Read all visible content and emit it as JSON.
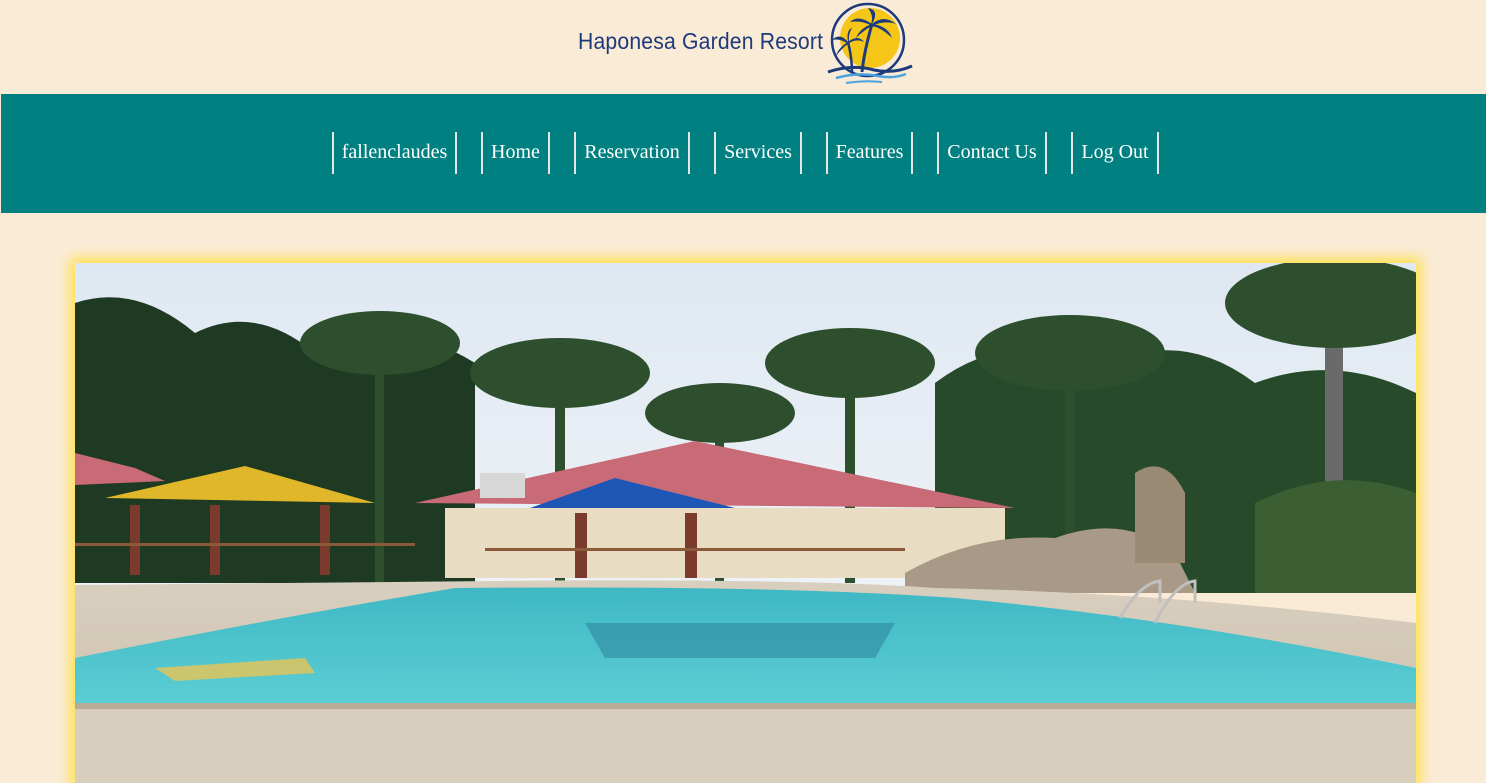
{
  "header": {
    "brand_name": "Haponesa Garden Resort",
    "logo_icon": "palm-tree-sun-logo-icon"
  },
  "nav": {
    "items": [
      {
        "label": "fallenclaudes"
      },
      {
        "label": "Home"
      },
      {
        "label": "Reservation"
      },
      {
        "label": "Services"
      },
      {
        "label": "Features"
      },
      {
        "label": "Contact Us"
      },
      {
        "label": "Log Out"
      }
    ]
  },
  "hero": {
    "image": "resort-pool-photo"
  },
  "colors": {
    "page_background": "#faebd7",
    "nav_background": "#008080",
    "brand_text": "#1d3a7a",
    "logo_sun": "#f5c518",
    "hero_glow": "#ffe14d"
  }
}
